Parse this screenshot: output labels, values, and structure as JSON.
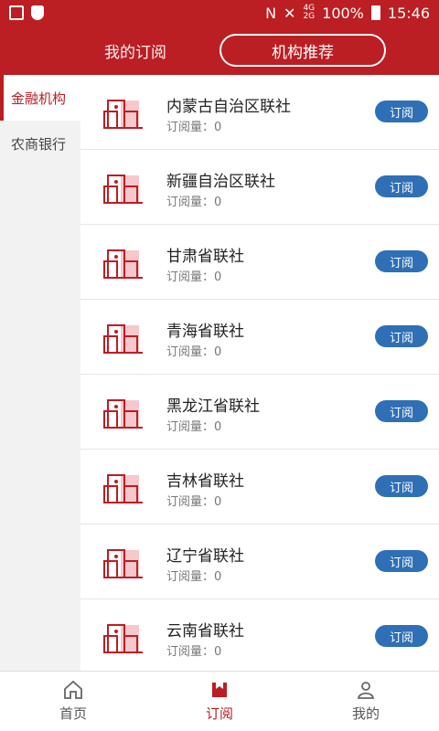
{
  "status_bar": {
    "network_top": "4G",
    "network_bottom": "2G",
    "battery": "100%",
    "time": "15:46"
  },
  "header": {
    "tabs": [
      {
        "label": "我的订阅"
      },
      {
        "label": "机构推荐"
      }
    ]
  },
  "sidebar": {
    "items": [
      {
        "label": "金融机构"
      },
      {
        "label": "农商银行"
      }
    ]
  },
  "institutions": [
    {
      "name": "内蒙古自治区联社",
      "subs": "订阅量：0",
      "btn": "订阅"
    },
    {
      "name": "新疆自治区联社",
      "subs": "订阅量：0",
      "btn": "订阅"
    },
    {
      "name": "甘肃省联社",
      "subs": "订阅量：0",
      "btn": "订阅"
    },
    {
      "name": "青海省联社",
      "subs": "订阅量：0",
      "btn": "订阅"
    },
    {
      "name": "黑龙江省联社",
      "subs": "订阅量：0",
      "btn": "订阅"
    },
    {
      "name": "吉林省联社",
      "subs": "订阅量：0",
      "btn": "订阅"
    },
    {
      "name": "辽宁省联社",
      "subs": "订阅量：0",
      "btn": "订阅"
    },
    {
      "name": "云南省联社",
      "subs": "订阅量：0",
      "btn": "订阅"
    }
  ],
  "bottom_nav": {
    "items": [
      {
        "label": "首页",
        "icon": "home-icon"
      },
      {
        "label": "订阅",
        "icon": "subscribe-icon"
      },
      {
        "label": "我的",
        "icon": "user-icon"
      }
    ]
  },
  "colors": {
    "primary_red": "#bb1e23",
    "button_blue": "#2f6fb5"
  }
}
